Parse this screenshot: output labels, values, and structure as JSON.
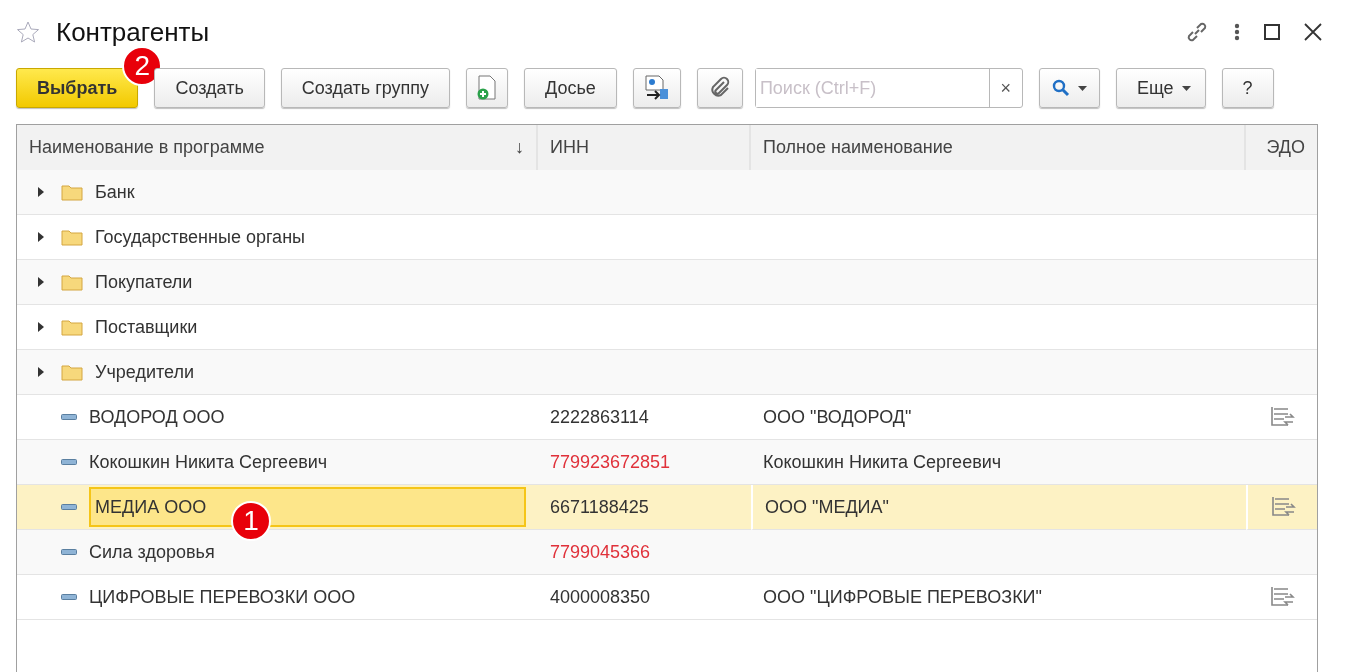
{
  "window": {
    "title": "Контрагенты"
  },
  "toolbar": [
    {
      "kind": "button",
      "label": "Выбрать",
      "default": true,
      "callout": "2"
    },
    {
      "kind": "button",
      "label": "Создать",
      "default": false
    },
    {
      "kind": "button",
      "label": "Создать группу",
      "default": false
    },
    {
      "kind": "add-document"
    },
    {
      "kind": "button",
      "label": "Досье",
      "default": false
    },
    {
      "kind": "export-document"
    },
    {
      "kind": "attach"
    },
    {
      "kind": "search",
      "placeholder": "Поиск (Ctrl+F)",
      "clear": "×"
    },
    {
      "kind": "search-menu"
    },
    {
      "kind": "menu",
      "label": "Еще"
    },
    {
      "kind": "button",
      "label": "?",
      "default": false
    }
  ],
  "table": {
    "columns": [
      {
        "label": "Наименование в программе",
        "sort": "↓"
      },
      {
        "label": "ИНН"
      },
      {
        "label": "Полное наименование"
      },
      {
        "label": "ЭДО"
      }
    ],
    "rows": [
      {
        "kind": "group",
        "name": "Банк",
        "expanded": false,
        "selected": false
      },
      {
        "kind": "group",
        "name": "Государственные органы",
        "expanded": false,
        "selected": false
      },
      {
        "kind": "group",
        "name": "Покупатели",
        "expanded": false,
        "selected": false
      },
      {
        "kind": "group",
        "name": "Поставщики",
        "expanded": false,
        "selected": false
      },
      {
        "kind": "group",
        "name": "Учредители",
        "expanded": false,
        "selected": false
      },
      {
        "kind": "item",
        "name": "ВОДОРОД ООО",
        "inn": "2222863114",
        "inn_error": false,
        "full_name": "ООО \"ВОДОРОД\"",
        "edo": true,
        "selected": false
      },
      {
        "kind": "item",
        "name": "Кокошкин Никита Сергеевич",
        "inn": "779923672851",
        "inn_error": true,
        "full_name": "Кокошкин Никита Сергеевич",
        "edo": false,
        "selected": false
      },
      {
        "kind": "item",
        "name": "МЕДИА ООО",
        "inn": "6671188425",
        "inn_error": false,
        "full_name": "ООО \"МЕДИА\"",
        "edo": true,
        "selected": true,
        "callout": "1"
      },
      {
        "kind": "item",
        "name": "Сила здоровья",
        "inn": "7799045366",
        "inn_error": true,
        "edo": false,
        "selected": false
      },
      {
        "kind": "item",
        "name": "ЦИФРОВЫЕ ПЕРЕВОЗКИ ООО",
        "inn": "4000008350",
        "inn_error": false,
        "full_name": "ООО \"ЦИФРОВЫЕ ПЕРЕВОЗКИ\"",
        "edo": true,
        "selected": false
      }
    ]
  }
}
